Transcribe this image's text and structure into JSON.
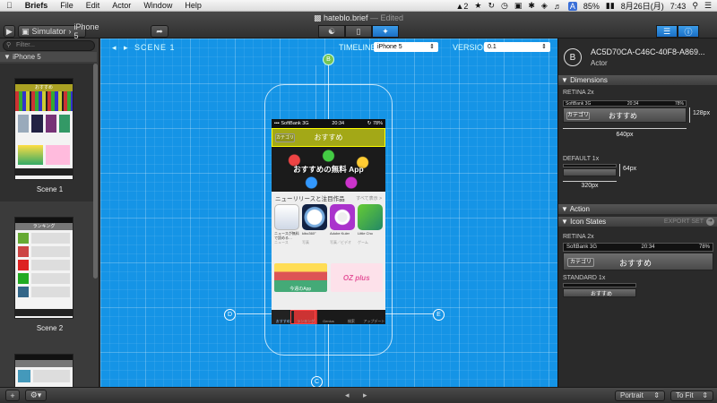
{
  "menubar": {
    "apple": "",
    "items": [
      "Briefs",
      "File",
      "Edit",
      "Actor",
      "Window",
      "Help"
    ],
    "status": {
      "notifications": "2",
      "battery": "85%",
      "date": "8月26日(月)",
      "time": "7:43",
      "input": "A"
    }
  },
  "window": {
    "title": "hateblo.brief",
    "edited": "— Edited",
    "simulator_label": "Simulator",
    "device": "iPhone 5"
  },
  "sidebar": {
    "filter_placeholder": "Filter...",
    "group": "iPhone 5",
    "scenes": [
      {
        "label": "Scene 1",
        "thumb_title": "おすすめ"
      },
      {
        "label": "Scene 2",
        "thumb_title": "ランキング"
      }
    ]
  },
  "canvas": {
    "scene_label": "SCENE 1",
    "timeline_label": "TIMELINE:",
    "timeline_value": "iPhone 5",
    "version_label": "VERSION:",
    "version_value": "0.1",
    "nodes": {
      "b": "B",
      "d": "D",
      "e": "E",
      "c": "C"
    }
  },
  "phone": {
    "carrier": "SoftBank",
    "network": "3G",
    "time": "20:34",
    "battery": "78%",
    "nav_title": "おすすめ",
    "nav_left": "カテゴリ",
    "banner": "おすすめの無料 App",
    "section_title": "ニューリリースと注目作品",
    "section_link": "すべて表示 >",
    "apps": [
      {
        "name": "ニュースが無料で読める…",
        "sub": "ニュース"
      },
      {
        "name": "kibo360°",
        "sub": "写真"
      },
      {
        "name": "Adobe Kuler",
        "sub": "写真／ビデオ"
      },
      {
        "name": "Little Cho",
        "sub": "ゲーム"
      }
    ],
    "promo1": "今週のApp",
    "promo2": "OZ plus",
    "tabs": [
      "おすすめ",
      "ランキング",
      "Genius",
      "検索",
      "アップデート"
    ]
  },
  "inspector": {
    "badge": "B",
    "id": "AC5D70CA-C46C-40F8-A869...",
    "type": "Actor",
    "dimensions_header": "Dimensions",
    "retina_label": "RETINA 2x",
    "retina_width": "640px",
    "retina_height": "128px",
    "default_label": "DEFAULT 1x",
    "default_width": "320px",
    "default_height": "64px",
    "action_header": "Action",
    "icon_states_header": "Icon States",
    "export_set": "EXPORT SET",
    "retina_state_label": "RETINA 2x",
    "standard_state_label": "STANDARD 1x"
  },
  "bottombar": {
    "orientation": "Portrait",
    "fit": "To Fit"
  }
}
